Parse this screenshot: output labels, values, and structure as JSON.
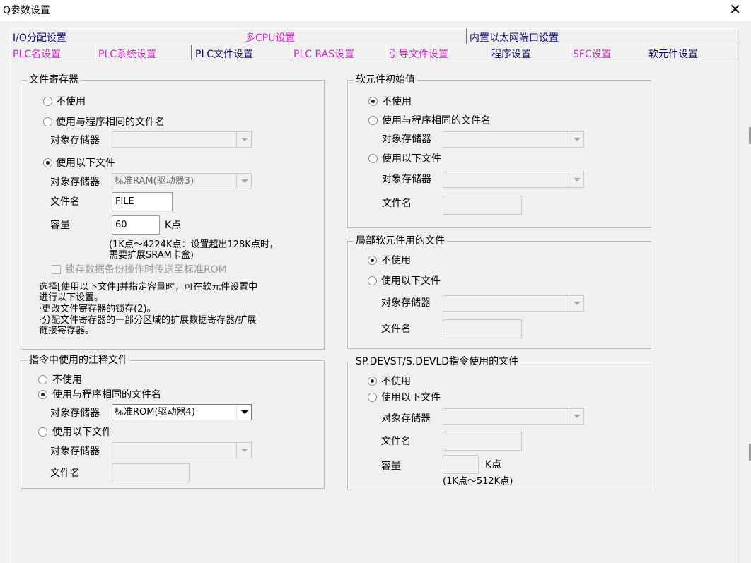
{
  "window": {
    "title": "Q参数设置",
    "close_glyph": "✕"
  },
  "tabs": {
    "row1": [
      "I/O分配设置",
      "多CPU设置",
      "内置以太网端口设置"
    ],
    "row2": [
      "PLC名设置",
      "PLC系统设置",
      "PLC文件设置",
      "PLC RAS设置",
      "引导文件设置",
      "程序设置",
      "SFC设置",
      "软元件设置"
    ],
    "active": "PLC文件设置"
  },
  "file_register": {
    "title": "文件寄存器",
    "opt_none": "不使用",
    "opt_same": "使用与程序相同的文件名",
    "target_memory_label": "对象存储器",
    "opt_following": "使用以下文件",
    "target_memory_value": "标准RAM(驱动器3)",
    "file_name_label": "文件名",
    "file_name_value": "FILE",
    "capacity_label": "容量",
    "capacity_value": "60",
    "capacity_unit": "K点",
    "range_note_1": "(1K点～4224K点：设置超出128K点时，",
    "range_note_2": "需要扩展SRAM卡盒)",
    "latch_checkbox": "锁存数据备份操作时传送至标准ROM",
    "desc_1": "选择[使用以下文件]并指定容量时，可在软元件设置中",
    "desc_2": "进行以下设置。",
    "desc_3": "·更改文件寄存器的锁存(2)。",
    "desc_4": "·分配文件寄存器的一部分区域的扩展数据寄存器/扩展",
    "desc_5": "链接寄存器。"
  },
  "comment_file": {
    "title": "指令中使用的注释文件",
    "opt_none": "不使用",
    "opt_same": "使用与程序相同的文件名",
    "target_memory_label": "对象存储器",
    "target_memory_value": "标准ROM(驱动器4)",
    "opt_following": "使用以下文件",
    "target_memory_label_2": "对象存储器",
    "file_name_label": "文件名"
  },
  "device_init": {
    "title": "软元件初始值",
    "opt_none": "不使用",
    "opt_same": "使用与程序相同的文件名",
    "target_memory_label": "对象存储器",
    "opt_following": "使用以下文件",
    "target_memory_label_2": "对象存储器",
    "file_name_label": "文件名"
  },
  "local_device": {
    "title": "局部软元件用的文件",
    "opt_none": "不使用",
    "opt_following": "使用以下文件",
    "target_memory_label": "对象存储器",
    "file_name_label": "文件名"
  },
  "sp_devst": {
    "title": "SP.DEVST/S.DEVLD指令使用的文件",
    "opt_none": "不使用",
    "opt_following": "使用以下文件",
    "target_memory_label": "对象存储器",
    "file_name_label": "文件名",
    "capacity_label": "容量",
    "capacity_unit": "K点",
    "range_note": "(1K点～512K点)"
  }
}
